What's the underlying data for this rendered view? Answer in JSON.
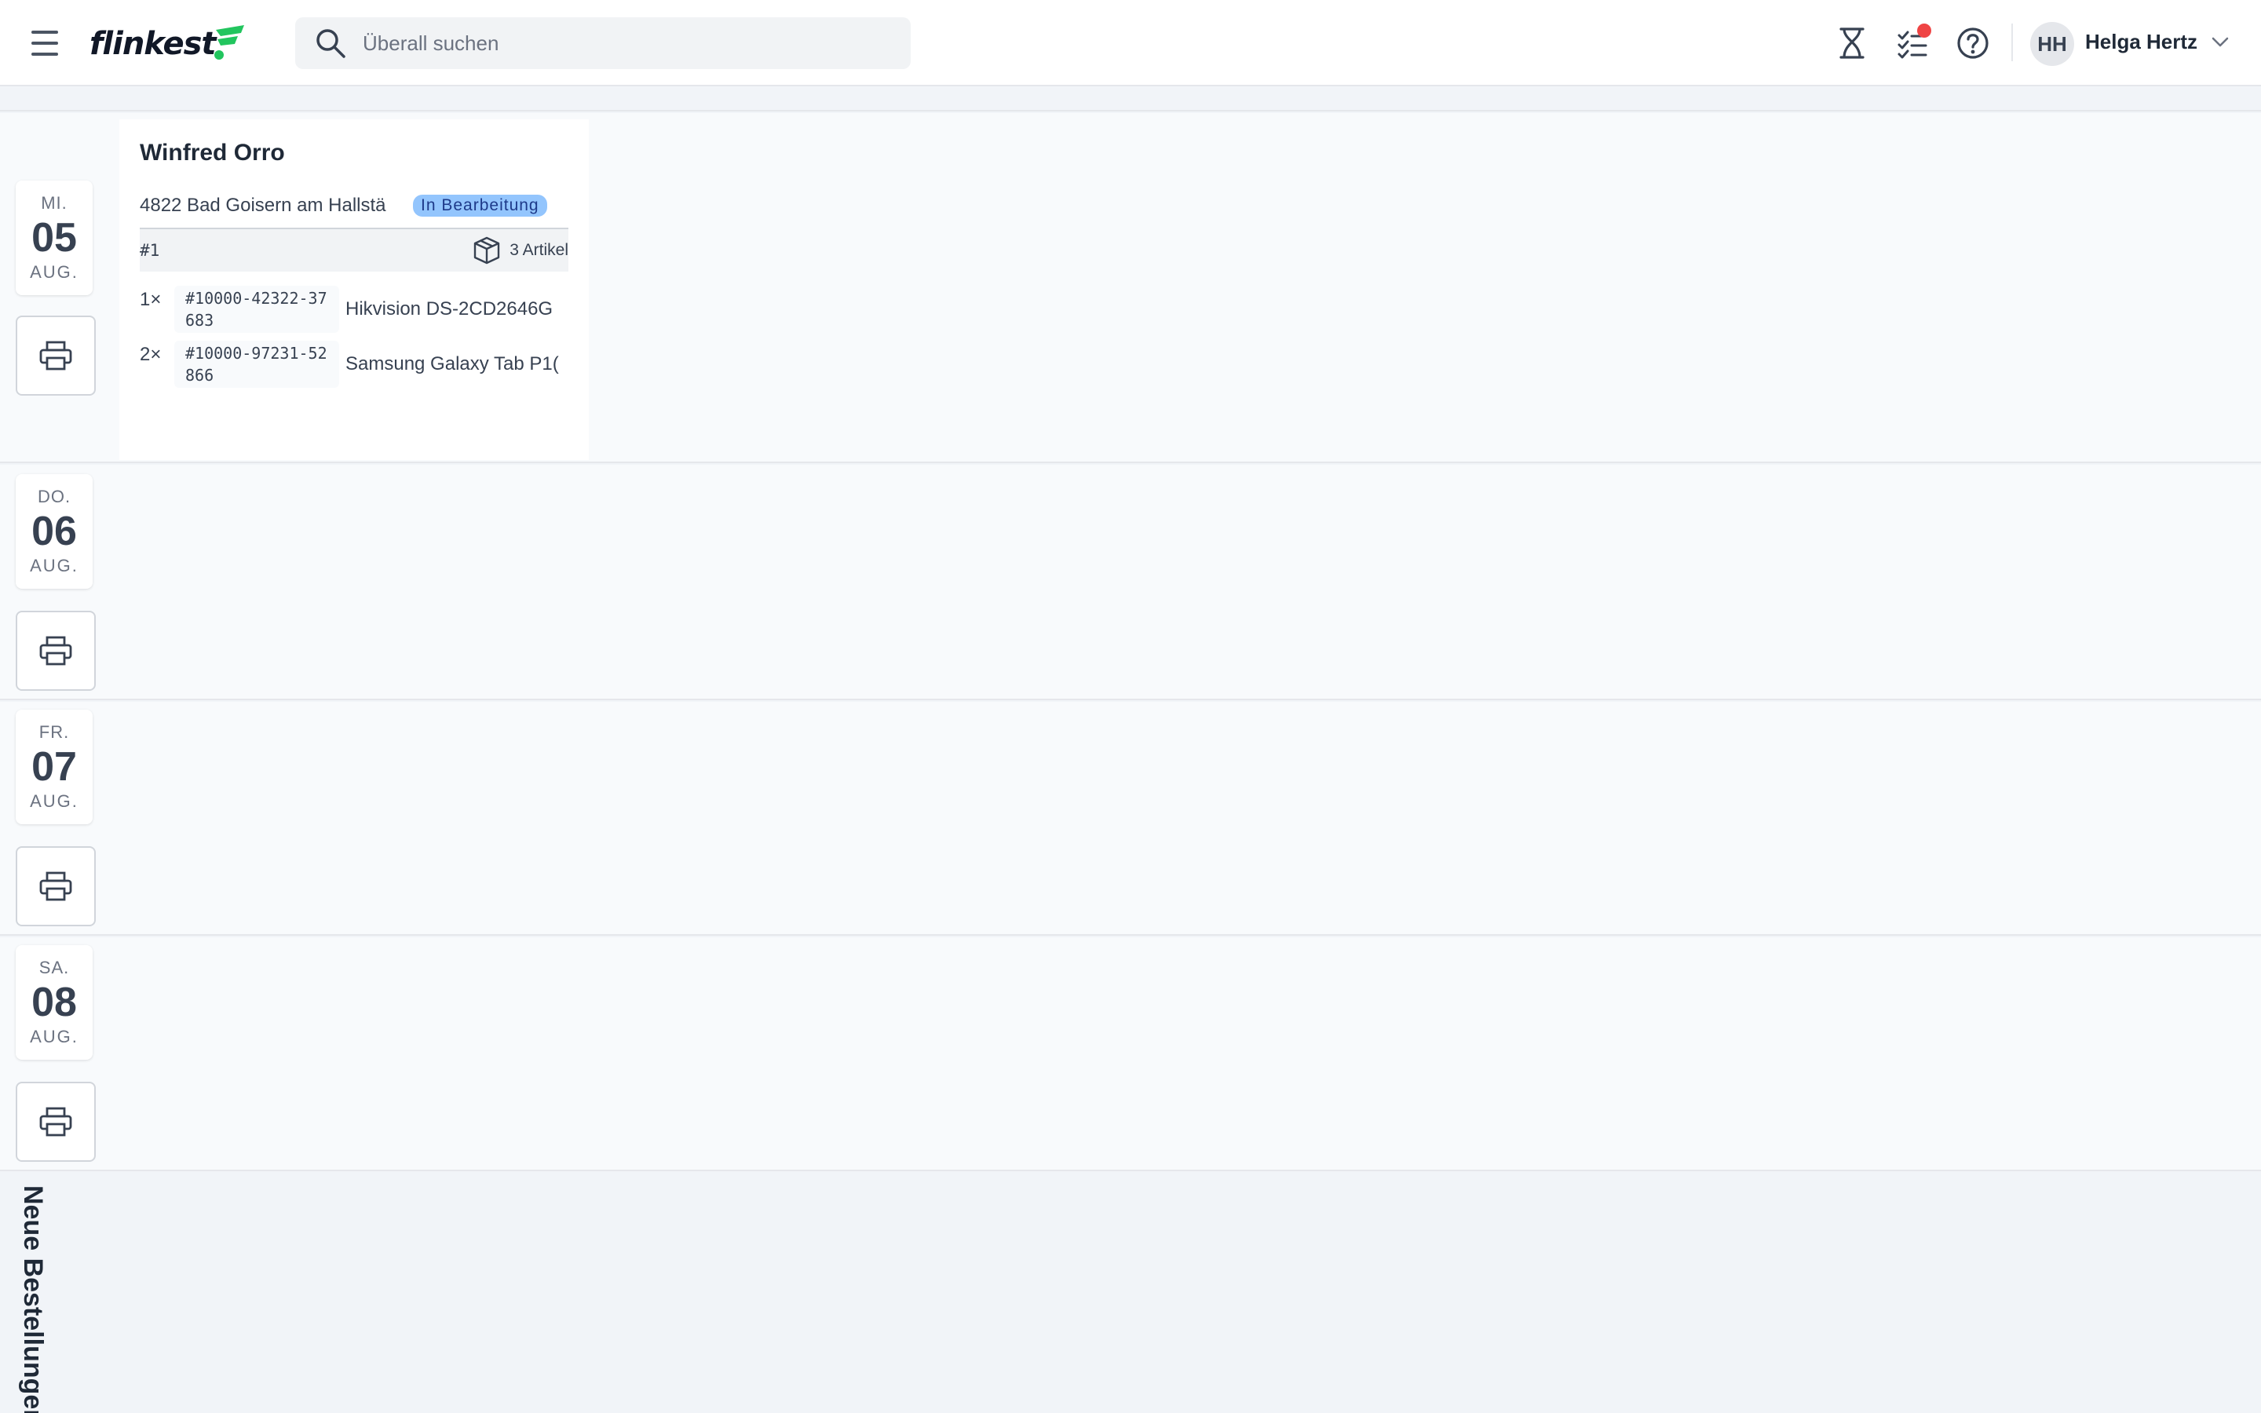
{
  "header": {
    "logo_text": "flinkest",
    "search_placeholder": "Überall suchen",
    "icons": [
      "menu-icon",
      "search-icon",
      "hourglass-icon",
      "tasks-icon",
      "help-icon",
      "chevron-down-icon"
    ],
    "user": {
      "initials": "HH",
      "name": "Helga Hertz"
    },
    "colors": {
      "brand_green": "#22c55e",
      "notification": "#ef4444"
    }
  },
  "days": [
    {
      "dow": "MI.",
      "day": "05",
      "month": "AUG."
    },
    {
      "dow": "DO.",
      "day": "06",
      "month": "AUG."
    },
    {
      "dow": "FR.",
      "day": "07",
      "month": "AUG."
    },
    {
      "dow": "SA.",
      "day": "08",
      "month": "AUG."
    }
  ],
  "order": {
    "customer": "Winfred Orro",
    "address": "4822 Bad Goisern am Hallstä",
    "status": "In Bearbeitung",
    "status_color": "#93c5fd",
    "package": {
      "number": "#1",
      "count_label": "3 Artikel"
    },
    "items": [
      {
        "qty": "1×",
        "sku": "#10000-42322-37683",
        "product": "Hikvision DS-2CD2646G"
      },
      {
        "qty": "2×",
        "sku": "#10000-97231-52866",
        "product": "Samsung Galaxy Tab P1("
      }
    ]
  },
  "side_label": "Neue Bestellungen"
}
